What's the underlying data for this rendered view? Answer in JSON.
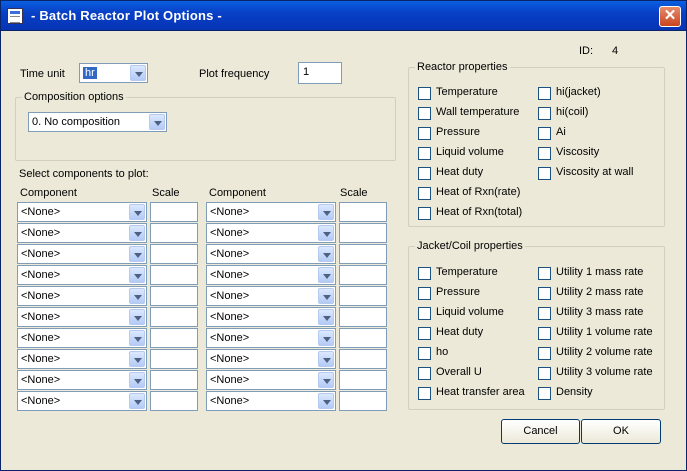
{
  "window": {
    "title": "- Batch Reactor Plot Options -",
    "close_label": "✕"
  },
  "id_label": "ID:",
  "id_value": "4",
  "time_unit": {
    "label": "Time unit",
    "value": "hr"
  },
  "plot_frequency": {
    "label": "Plot frequency",
    "value": "1"
  },
  "composition": {
    "legend": "Composition options",
    "value": "0.  No composition"
  },
  "components": {
    "label": "Select components to plot:",
    "col_component": "Component",
    "col_scale": "Scale",
    "none_value": "<None>",
    "rows": 10
  },
  "reactor_properties": {
    "legend": "Reactor properties",
    "left": [
      "Temperature",
      "Wall temperature",
      "Pressure",
      "Liquid volume",
      "Heat duty",
      "Heat of Rxn(rate)",
      "Heat of Rxn(total)"
    ],
    "right": [
      "hi(jacket)",
      "hi(coil)",
      "Ai",
      "Viscosity",
      "Viscosity at wall"
    ]
  },
  "jacket_properties": {
    "legend": "Jacket/Coil properties",
    "left": [
      "Temperature",
      "Pressure",
      "Liquid volume",
      "Heat duty",
      "ho",
      "Overall U",
      "Heat transfer area"
    ],
    "right": [
      "Utility 1 mass rate",
      "Utility 2 mass rate",
      "Utility 3 mass rate",
      "Utility 1 volume rate",
      "Utility 2 volume rate",
      "Utility 3 volume rate",
      "Density"
    ]
  },
  "buttons": {
    "cancel": "Cancel",
    "ok": "OK"
  }
}
